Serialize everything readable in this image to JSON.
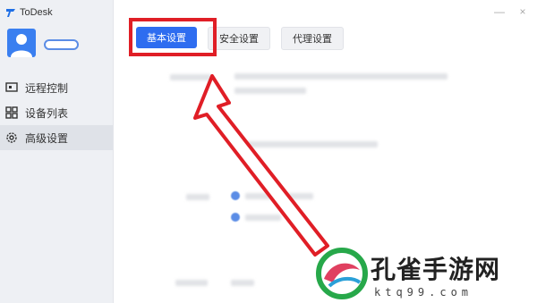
{
  "app": {
    "title": "ToDesk"
  },
  "sidebar": {
    "items": [
      {
        "label": "远程控制",
        "icon": "monitor-icon"
      },
      {
        "label": "设备列表",
        "icon": "grid-icon"
      },
      {
        "label": "高级设置",
        "icon": "gear-icon",
        "active": true
      }
    ]
  },
  "window_controls": {
    "minimize": "—",
    "close": "×"
  },
  "tabs": [
    {
      "label": "基本设置",
      "active": true
    },
    {
      "label": "安全设置",
      "active": false
    },
    {
      "label": "代理设置",
      "active": false
    }
  ],
  "watermark": {
    "name": "孔雀手游网",
    "url": "ktq99.com"
  },
  "colors": {
    "accent": "#2e6df0",
    "annotation": "#e01e26",
    "sidebar_bg": "#eef0f4"
  }
}
